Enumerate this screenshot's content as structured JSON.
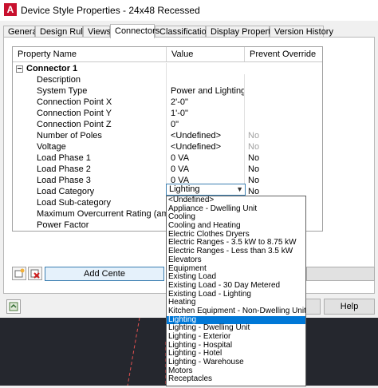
{
  "window": {
    "title": "Device Style Properties - 24x48 Recessed",
    "app_icon": "A"
  },
  "tabs": [
    {
      "label": "General"
    },
    {
      "label": "Design Rules"
    },
    {
      "label": "Views"
    },
    {
      "label": "Connectors"
    },
    {
      "label": "Classifications"
    },
    {
      "label": "Display Properties"
    },
    {
      "label": "Version History"
    }
  ],
  "active_tab": "Connectors",
  "grid": {
    "headers": {
      "property": "Property Name",
      "value": "Value",
      "override": "Prevent Override"
    },
    "group": {
      "expander": "−",
      "label": "Connector 1"
    },
    "rows": [
      {
        "name": "Description",
        "value": "",
        "override": ""
      },
      {
        "name": "System Type",
        "value": "Power and Lighting",
        "override": ""
      },
      {
        "name": "Connection Point X",
        "value": "2'-0\"",
        "override": ""
      },
      {
        "name": "Connection Point Y",
        "value": "1'-0\"",
        "override": ""
      },
      {
        "name": "Connection Point Z",
        "value": "0\"",
        "override": ""
      },
      {
        "name": "Number of Poles",
        "value": "<Undefined>",
        "override": "No"
      },
      {
        "name": "Voltage",
        "value": "<Undefined>",
        "override": "No"
      },
      {
        "name": "Load Phase 1",
        "value": "0 VA",
        "override": "No"
      },
      {
        "name": "Load Phase 2",
        "value": "0 VA",
        "override": "No"
      },
      {
        "name": "Load Phase 3",
        "value": "0 VA",
        "override": "No"
      },
      {
        "name": "Load Category",
        "value": "Lighting",
        "override": "No"
      },
      {
        "name": "Load Sub-category",
        "value": "",
        "override": ""
      },
      {
        "name": "Maximum Overcurrent Rating (amps)",
        "value": "",
        "override": ""
      },
      {
        "name": "Power Factor",
        "value": "",
        "override": ""
      }
    ]
  },
  "dropdown": {
    "selected": "Lighting",
    "options": [
      "<Undefined>",
      "Appliance - Dwelling Unit",
      "Cooling",
      "Cooling and Heating",
      "Electric Clothes Dryers",
      "Electric Ranges - 3.5 kW to 8.75 kW",
      "Electric Ranges - Less than 3.5 kW",
      "Elevators",
      "Equipment",
      "Existing Load",
      "Existing Load - 30 Day Metered",
      "Existing Load - Lighting",
      "Heating",
      "Kitchen Equipment - Non-Dwelling Unit",
      "Lighting",
      "Lighting - Dwelling Unit",
      "Lighting - Exterior",
      "Lighting - Hospital",
      "Lighting - Hotel",
      "Lighting - Warehouse",
      "Motors",
      "Receptacles"
    ]
  },
  "buttons": {
    "add_connector": "Add Cente",
    "help": "Help"
  },
  "colors": {
    "selection": "#0078d7",
    "app_icon": "#c8102e",
    "canvas": "#25272e",
    "canvas_line": "#e05050"
  }
}
